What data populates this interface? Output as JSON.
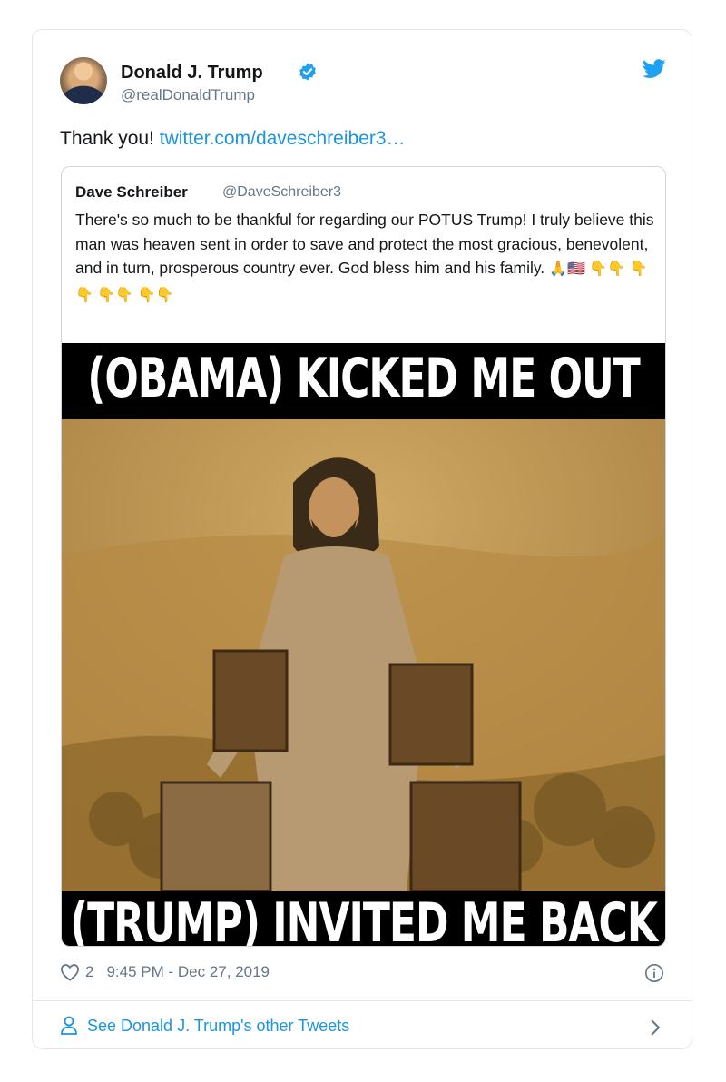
{
  "tweet": {
    "author_name": "Donald J. Trump",
    "author_handle": "@realDonaldTrump",
    "text_prefix": "Thank you!",
    "link_text": "twitter.com/daveschreiber3…",
    "quoted": {
      "author_name": "Dave Schreiber",
      "author_handle": "@DaveSchreiber3",
      "text": "There's so much to be thankful for regarding our POTUS Trump! I truly believe this man was heaven sent in order to save and protect the most gracious, benevolent, and in turn, prosperous country ever. God bless him and his family.",
      "emojis": "🙏🇺🇸 👇👇 👇👇 👇👇 👇👇",
      "image": {
        "top_caption": "(OBAMA) KICKED ME OUT",
        "bottom_caption": "(TRUMP) INVITED ME BACK"
      }
    },
    "like_count": "2",
    "timestamp": "9:45 PM - Dec 27, 2019",
    "see_more": "See Donald J. Trump's other Tweets"
  },
  "colors": {
    "link": "#1b95e0",
    "muted": "#657786",
    "border": "#e1e8ed"
  },
  "icons": [
    "verified-badge-icon",
    "twitter-bird-icon",
    "heart-icon",
    "info-icon",
    "person-icon",
    "chevron-right-icon"
  ]
}
